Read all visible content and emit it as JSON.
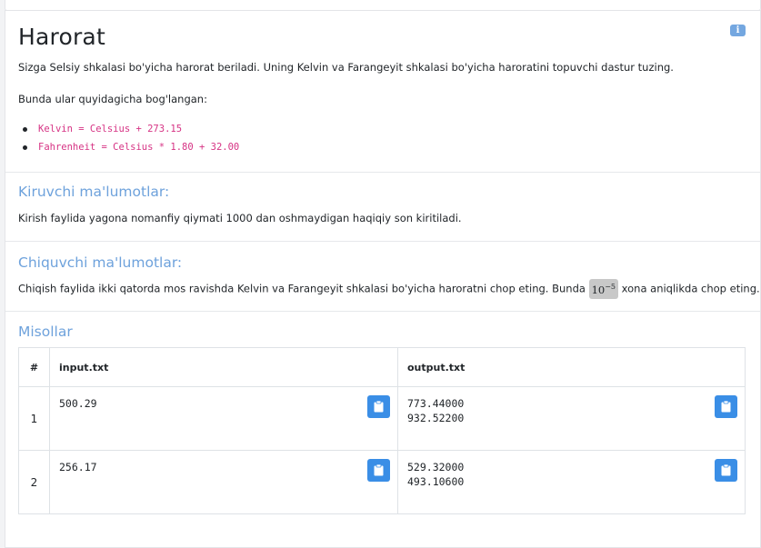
{
  "problem": {
    "title": "Harorat",
    "description": "Sizga Selsiy shkalasi bo'yicha harorat beriladi. Uning Kelvin va Farangeyit shkalasi bo'yicha haroratini topuvchi dastur tuzing.",
    "relation_intro": "Bunda ular quyidagicha bog'langan:",
    "formulas": [
      "Kelvin = Celsius + 273.15",
      "Fahrenheit = Celsius * 1.80 + 32.00"
    ]
  },
  "input_section": {
    "heading": "Kiruvchi ma'lumotlar:",
    "text": "Kirish faylida yagona nomanfiy qiymati 1000 dan oshmaydigan haqiqiy son kiritiladi."
  },
  "output_section": {
    "heading": "Chiquvchi ma'lumotlar:",
    "text_before": "Chiqish faylida ikki qatorda mos ravishda Kelvin va Farangeyit shkalasi bo'yicha haroratni chop eting. Bunda",
    "precision_base": "10",
    "precision_exp": "−5",
    "text_after": "xona aniqlikda chop eting."
  },
  "examples": {
    "heading": "Misollar",
    "columns": [
      "#",
      "input.txt",
      "output.txt"
    ],
    "rows": [
      {
        "num": "1",
        "input": "500.29",
        "output": "773.44000\n932.52200"
      },
      {
        "num": "2",
        "input": "256.17",
        "output": "529.32000\n493.10600"
      }
    ]
  },
  "icons": {
    "info": "info-icon",
    "copy": "clipboard-icon"
  },
  "colors": {
    "accent": "#6ea2dc",
    "copy_button": "#3a8ee6",
    "code": "#d63384"
  }
}
